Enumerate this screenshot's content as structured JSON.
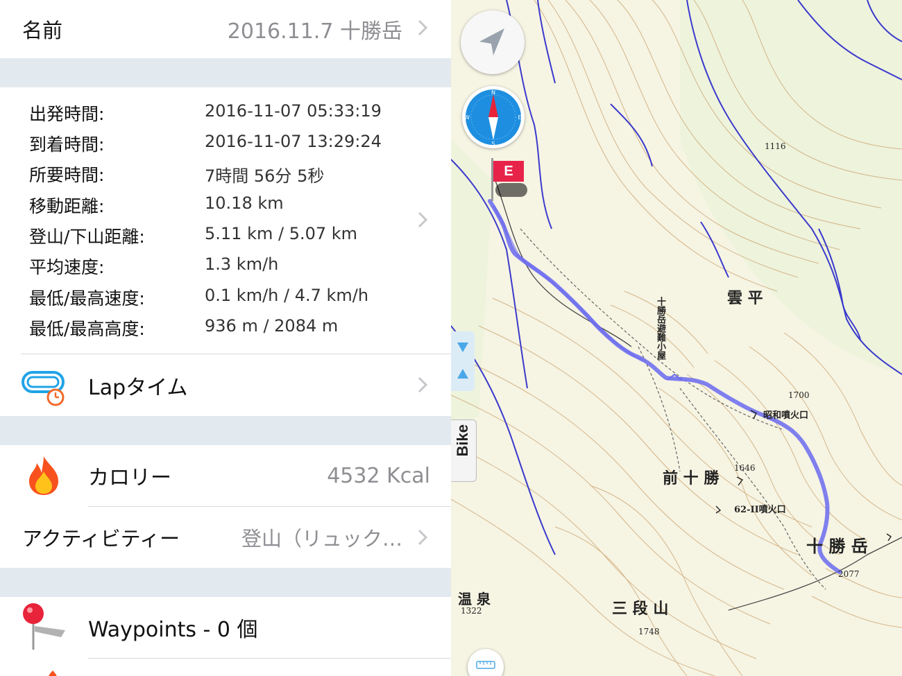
{
  "name_row": {
    "label": "名前",
    "value": "2016.11.7 十勝岳"
  },
  "stats": [
    {
      "label": "出発時間:",
      "value": "2016-11-07 05:33:19"
    },
    {
      "label": "到着時間:",
      "value": "2016-11-07 13:29:24"
    },
    {
      "label": "所要時間:",
      "value": "7時間 56分 5秒"
    },
    {
      "label": "移動距離:",
      "value": "10.18 km"
    },
    {
      "label": "登山/下山距離:",
      "value": "5.11 km / 5.07 km"
    },
    {
      "label": "平均速度:",
      "value": "1.3 km/h"
    },
    {
      "label": "最低/最高速度:",
      "value": "0.1 km/h / 4.7 km/h"
    },
    {
      "label": "最低/最高高度:",
      "value": "936 m / 2084 m"
    }
  ],
  "lap": {
    "label": "Lapタイム"
  },
  "calorie": {
    "label": "カロリー",
    "value": "4532 Kcal"
  },
  "activity": {
    "label": "アクティビティー",
    "value": "登山（リュック…"
  },
  "waypoints": {
    "label": "Waypoints - 0 個"
  },
  "map": {
    "end_marker": "E",
    "side_tab": "Bike",
    "labels": {
      "kumo_taira": "雲 平",
      "mae_tokachi": "前 十 勝",
      "tokachi_dake": "十 勝 岳",
      "sandan_yama": "三 段 山",
      "showa_crater": "昭和噴火口",
      "crater_62": "62-II噴火口",
      "hut": "十勝岳避難小屋",
      "onsen": "温 泉",
      "e1116": "1116",
      "e1700": "1700",
      "e1646": "1646",
      "e1322": "1322",
      "e1748": "1748",
      "e2077": "2077"
    }
  },
  "colors": {
    "track": "#6a6af0",
    "river": "#3a3acc",
    "separator": "#e2e9ef",
    "compass_blue": "#1e8fe0",
    "flag_red": "#e8234a"
  },
  "icons": {
    "locate": "location-arrow-icon",
    "compass": "compass-icon",
    "lap": "lap-timer-icon",
    "calorie": "flame-icon",
    "waypoint": "pin-icon"
  }
}
